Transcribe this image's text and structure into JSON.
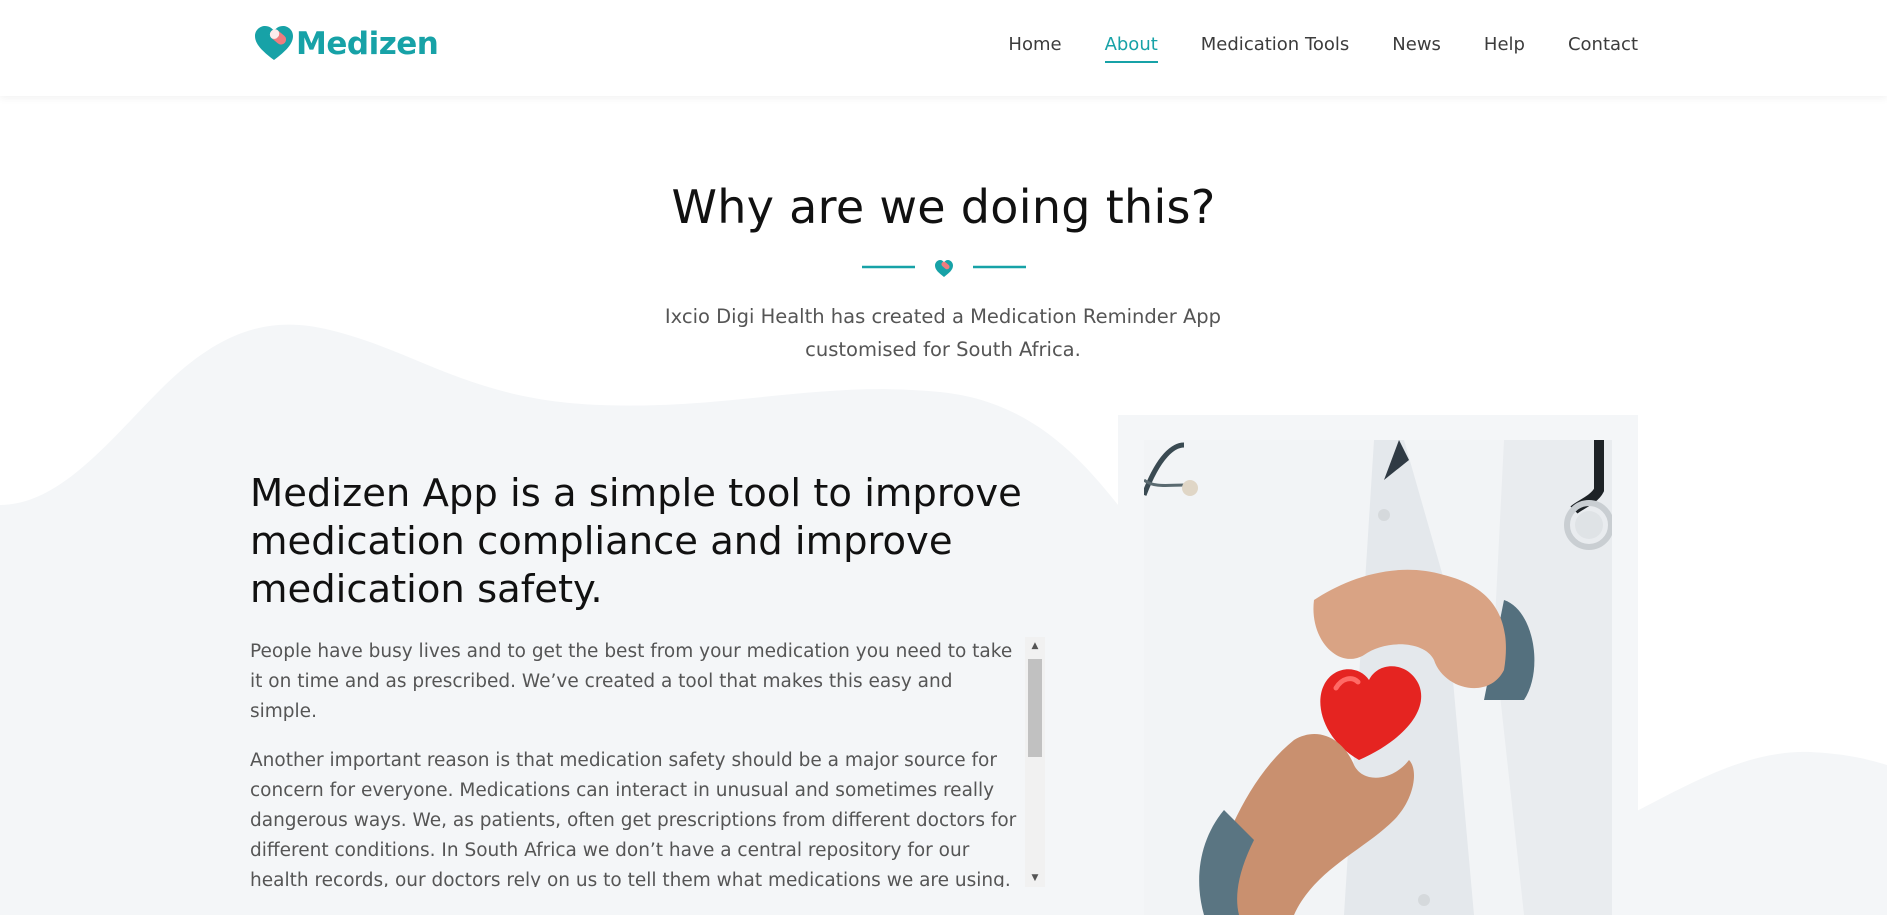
{
  "header": {
    "logo_text": "Medizen",
    "nav": [
      {
        "label": "Home",
        "active": false
      },
      {
        "label": "About",
        "active": true
      },
      {
        "label": "Medication Tools",
        "active": false
      },
      {
        "label": "News",
        "active": false
      },
      {
        "label": "Help",
        "active": false
      },
      {
        "label": "Contact",
        "active": false
      }
    ]
  },
  "section": {
    "title": "Why are we doing this?",
    "subtitle": "Ixcio Digi Health has created a Medication Reminder App customised for South Africa."
  },
  "main": {
    "headline": "Medizen App is a simple tool to improve medication compliance and improve medication safety.",
    "paragraphs": [
      "People have busy lives and to get the best from your medication you need to take it on time and as prescribed. We’ve created a tool that makes this easy and simple.",
      "Another important reason is that medication safety should be a major source for concern for everyone. Medications can interact in unusual and sometimes really dangerous ways. We, as patients, often get prescriptions from different doctors for different conditions. In South Africa we don’t have a central repository for our health records, our doctors rely on us to tell them what medications we are using. They only know what they’ve prescribed for us. Sometimes we forget, sometimes"
    ]
  },
  "icons": {
    "logo": "heart-pill-logo-icon",
    "divider": "heart-pill-icon",
    "scroll_up": "triangle-up-icon",
    "scroll_down": "triangle-down-icon"
  },
  "colors": {
    "brand": "#17a2a7",
    "accent_pink": "#f07c7f",
    "text_dark": "#111111",
    "text_body": "#555555",
    "wave_bg": "#f4f6f8"
  }
}
